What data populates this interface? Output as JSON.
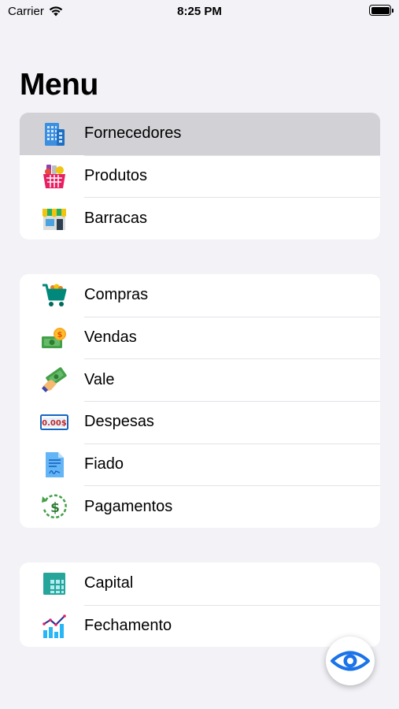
{
  "status_bar": {
    "carrier": "Carrier",
    "time": "8:25 PM"
  },
  "page": {
    "title": "Menu"
  },
  "groups": [
    {
      "items": [
        {
          "label": "Fornecedores",
          "icon": "office-building-icon",
          "selected": true
        },
        {
          "label": "Produtos",
          "icon": "shopping-basket-icon"
        },
        {
          "label": "Barracas",
          "icon": "store-stall-icon"
        }
      ]
    },
    {
      "items": [
        {
          "label": "Compras",
          "icon": "shopping-cart-icon"
        },
        {
          "label": "Vendas",
          "icon": "money-coins-icon"
        },
        {
          "label": "Vale",
          "icon": "hand-money-icon"
        },
        {
          "label": "Despesas",
          "icon": "expense-display-icon",
          "icon_text": "0.00$"
        },
        {
          "label": "Fiado",
          "icon": "document-icon"
        },
        {
          "label": "Pagamentos",
          "icon": "refund-dollar-icon",
          "icon_text": "$"
        }
      ]
    },
    {
      "items": [
        {
          "label": "Capital",
          "icon": "spreadsheet-icon"
        },
        {
          "label": "Fechamento",
          "icon": "bar-chart-icon"
        }
      ]
    }
  ],
  "fab": {
    "icon": "eye-icon"
  },
  "colors": {
    "background": "#f2f2f7",
    "selected_row": "#d1d1d6",
    "accent": "#1a73e8"
  }
}
